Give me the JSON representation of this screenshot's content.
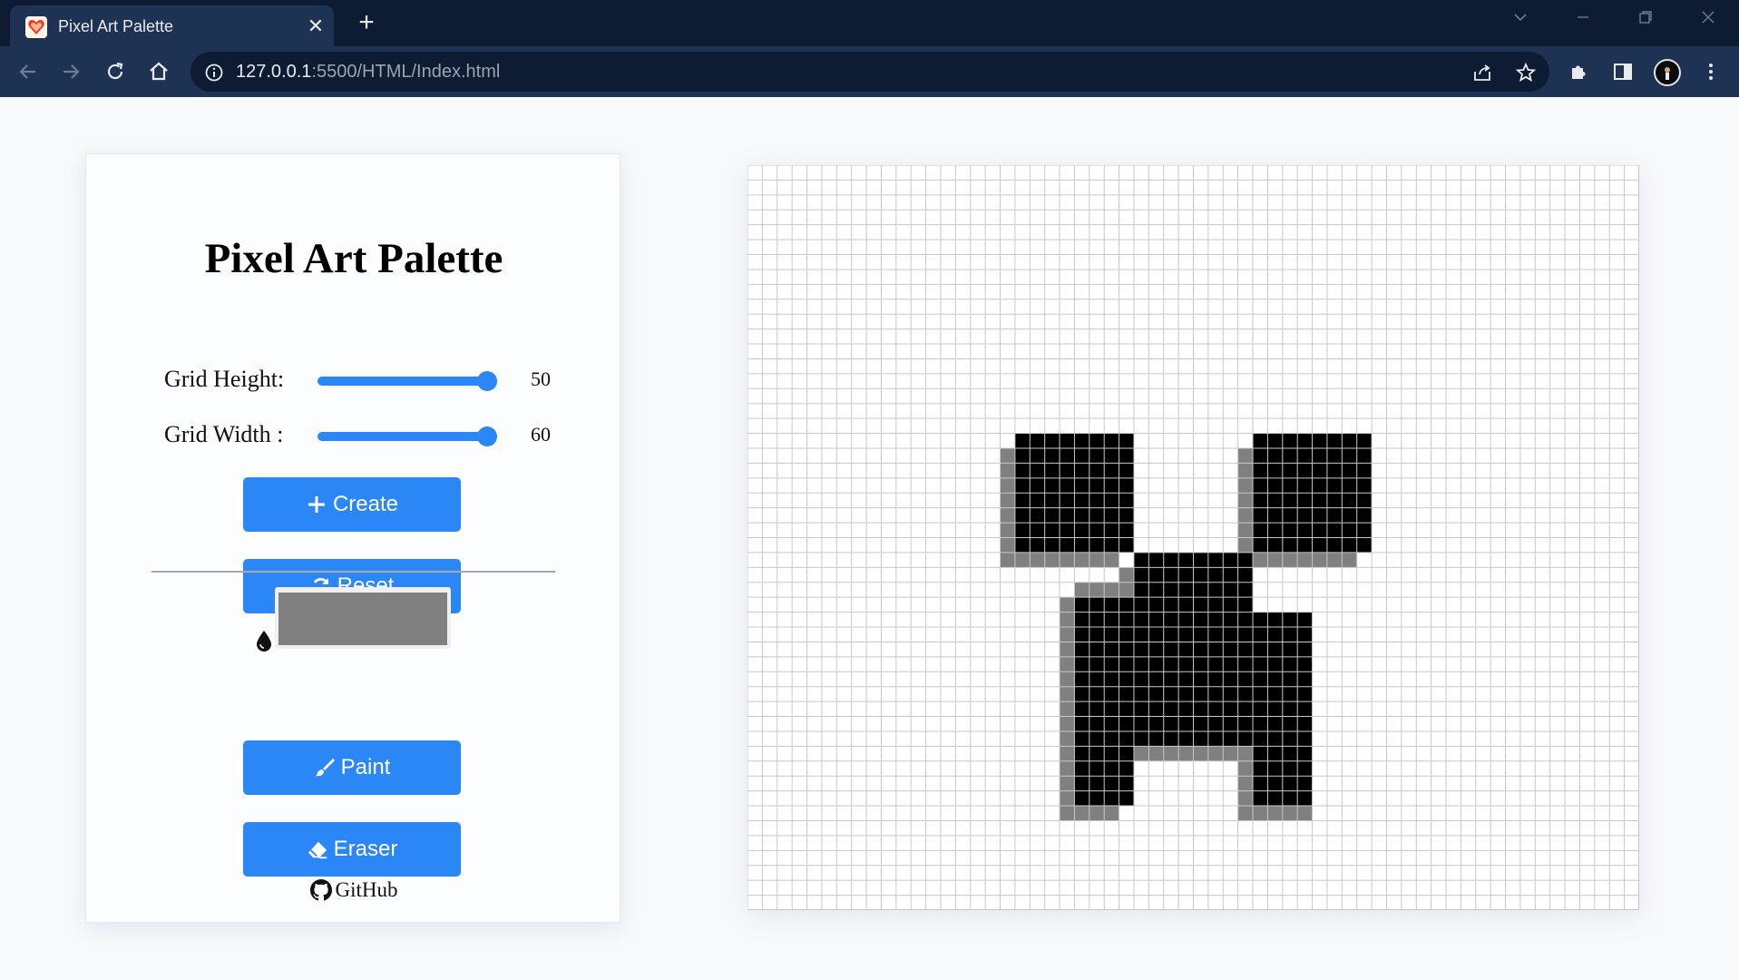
{
  "browser": {
    "tab_title": "Pixel Art Palette",
    "tab_close": "✕",
    "new_tab": "+",
    "url_host": "127.0.0.1",
    "url_rest": ":5500/HTML/Index.html"
  },
  "app": {
    "title": "Pixel Art Palette",
    "grid_height_label": "Grid Height:",
    "grid_height_value": "50",
    "grid_width_label": "Grid Width :",
    "grid_width_value": "60",
    "create_label": "Create",
    "reset_label": "Reset",
    "paint_label": "Paint",
    "eraser_label": "Eraser",
    "github_label": "GitHub",
    "selected_color": "#808080",
    "accent_color": "#2a87f5"
  },
  "grid": {
    "rows": 50,
    "cols": 60,
    "pixels": {
      "black": [
        "18,18-25",
        "19,18-25",
        "20,18-25",
        "21,18-25",
        "22,18-25",
        "23,18-25",
        "24,18-25",
        "25,18-25",
        "18,34-41",
        "19,34-41",
        "20,34-41",
        "21,34-41",
        "22,34-41",
        "23,34-41",
        "24,34-41",
        "25,34-41",
        "26,26-33",
        "27,26-33",
        "28,26-33",
        "29,26-33",
        "30,26-33",
        "31,26-33",
        "32,26-33",
        "33,26-33",
        "34,26-33",
        "35,26-33",
        "36,26-33",
        "37,26-33",
        "38,26-33",
        "29,22-25",
        "30,22-25",
        "31,22-25",
        "32,22-25",
        "33,22-25",
        "34,22-25",
        "35,22-25",
        "36,22-25",
        "37,22-25",
        "38,22-25",
        "39,22-25",
        "40,22-25",
        "41,22-25",
        "42,22-25",
        "30,34-37",
        "31,34-37",
        "32,34-37",
        "33,34-37",
        "34,34-37",
        "35,34-37",
        "36,34-37",
        "37,34-37",
        "38,34-37",
        "39,34-37",
        "40,34-37",
        "41,34-37",
        "42,34-37"
      ],
      "gray": [
        "19,17",
        "20,17",
        "21,17",
        "22,17",
        "23,17",
        "24,17",
        "25,17",
        "26,17-24",
        "19,33",
        "20,33",
        "21,33",
        "22,33",
        "23,33",
        "24,33",
        "25,33",
        "26,34-40",
        "27,25",
        "28,25",
        "28,22-24",
        "29,21",
        "30,21",
        "31,21",
        "32,21",
        "33,21",
        "34,21",
        "35,21",
        "36,21",
        "37,21",
        "38,21",
        "39,21",
        "40,21",
        "41,21",
        "42,21",
        "43,21-24",
        "39,26-33",
        "39,33",
        "40,33",
        "41,33",
        "42,33",
        "43,33-37"
      ]
    }
  }
}
